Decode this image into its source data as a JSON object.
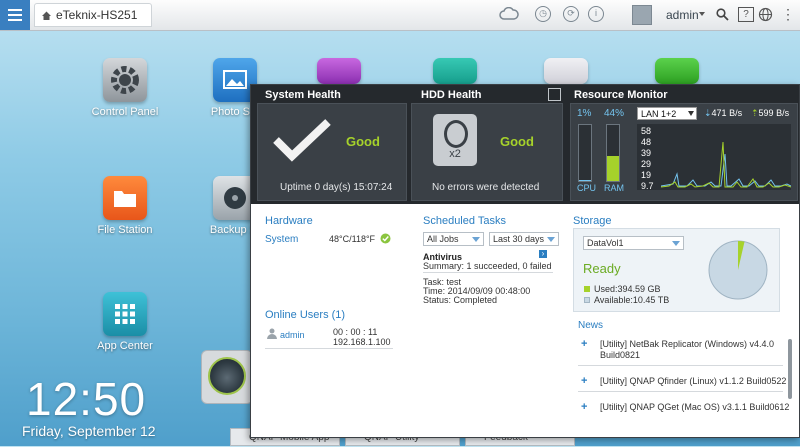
{
  "topbar": {
    "home_tab": "eTeknix-HS251",
    "user": "admin",
    "icons": [
      "menu-icon",
      "home-icon",
      "cloud-icon",
      "clock-icon",
      "sync-icon",
      "info-icon",
      "avatar",
      "search-icon",
      "help-icon",
      "globe-icon",
      "more-icon"
    ]
  },
  "desktop": {
    "apps": [
      {
        "label": "Control Panel"
      },
      {
        "label": "Photo Sta"
      },
      {
        "label": "File Station"
      },
      {
        "label": "Backup St"
      },
      {
        "label": "App Center"
      }
    ],
    "clock": "12:50",
    "date": "Friday, September 12",
    "taskbar": [
      "QNAP Mobile App",
      "QNAP Utility",
      "Feedback"
    ]
  },
  "dashboard": {
    "system_health": {
      "title": "System Health",
      "status": "Good",
      "uptime": "Uptime 0 day(s) 15:07:24"
    },
    "hdd_health": {
      "title": "HDD Health",
      "status": "Good",
      "disk_label": "x2",
      "detail": "No errors were detected"
    },
    "resource_monitor": {
      "title": "Resource Monitor",
      "cpu_pct": "1%",
      "ram_pct": "44%",
      "cpu_value": 0.01,
      "ram_value": 0.44,
      "cpu_label": "CPU",
      "ram_label": "RAM",
      "lan": "LAN 1+2",
      "down": "471 B/s",
      "up": "599 B/s",
      "y_ticks": [
        "58",
        "48",
        "39",
        "29",
        "19",
        "9.7"
      ],
      "colors": {
        "cpu": "#74c4ef",
        "ram": "#a6d22b",
        "net_up": "#74c4ef",
        "net_down": "#a6d22b"
      }
    },
    "hardware": {
      "title": "Hardware",
      "label": "System",
      "temp": "48°C/118°F"
    },
    "online_users": {
      "title": "Online Users (1)",
      "user": "admin",
      "time": "00 : 00 : 11",
      "ip": "192.168.1.100"
    },
    "scheduled_tasks": {
      "title": "Scheduled Tasks",
      "filter_jobs": "All Jobs",
      "filter_range": "Last 30 days",
      "task_name": "Antivirus",
      "summary": "Summary: 1 succeeded, 0 failed",
      "task_line": "Task: test",
      "time_line": "Time: 2014/09/09 00:48:00",
      "status_line": "Status: Completed"
    },
    "storage": {
      "title": "Storage",
      "volume": "DataVol1",
      "status": "Ready",
      "used": "Used:394.59 GB",
      "available": "Available:10.45 TB",
      "used_fraction": 0.036,
      "colors": {
        "used": "#a6d22b",
        "available": "#c8d8e4"
      }
    },
    "news": {
      "title": "News",
      "items": [
        {
          "line1": "[Utility] NetBak Replicator (Windows) v4.4.0",
          "line2": "Build0821"
        },
        {
          "line1": "[Utility] QNAP Qfinder (Linux) v1.1.2 Build0522",
          "line2": ""
        },
        {
          "line1": "[Utility] QNAP QGet (Mac OS) v3.1.1 Build0612",
          "line2": ""
        }
      ]
    }
  }
}
